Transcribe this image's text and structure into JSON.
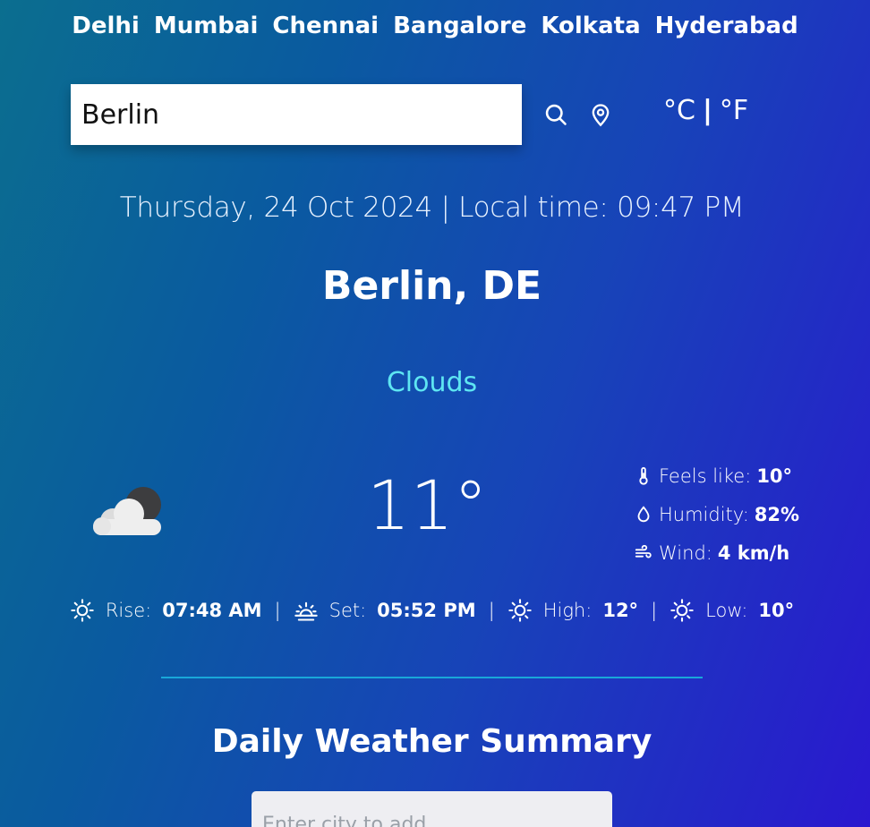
{
  "cities": [
    "Delhi",
    "Mumbai",
    "Chennai",
    "Bangalore",
    "Kolkata",
    "Hyderabad"
  ],
  "search": {
    "value": "Berlin"
  },
  "units": {
    "celsius": "°C",
    "separator": "|",
    "fahrenheit": "°F"
  },
  "datetime": "Thursday, 24 Oct 2024 | Local time: 09:47 PM",
  "location": "Berlin, DE",
  "condition": "Clouds",
  "weather_icon": "clouds-night-icon",
  "temperature": "11°",
  "details": {
    "feels_like": {
      "label": "Feels like:",
      "value": "10°"
    },
    "humidity": {
      "label": "Humidity:",
      "value": "82%"
    },
    "wind": {
      "label": "Wind:",
      "value": "4 km/h"
    }
  },
  "sun": {
    "rise": {
      "label": "Rise:",
      "value": "07:48 AM"
    },
    "set": {
      "label": "Set:",
      "value": "05:52 PM"
    },
    "high": {
      "label": "High:",
      "value": "12°"
    },
    "low": {
      "label": "Low:",
      "value": "10°"
    },
    "separator": "|"
  },
  "summary": {
    "title": "Daily Weather Summary",
    "input_placeholder": "Enter city to add"
  },
  "colors": {
    "condition": "#5ee6f2",
    "divider": "#19a7d9"
  }
}
